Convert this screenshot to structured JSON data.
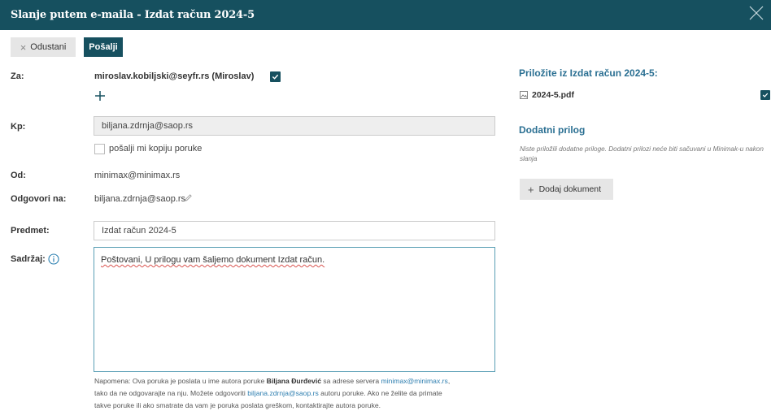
{
  "dialog": {
    "title": "Slanje putem e-maila - Izdat račun 2024-5"
  },
  "toolbar": {
    "cancel_label": "Odustani",
    "send_label": "Pošalji"
  },
  "form": {
    "to_label": "Za:",
    "to_value": "miroslav.kobiljski@seyfr.rs (Miroslav)",
    "to_checked": true,
    "cc_label": "Kp:",
    "cc_value": "biljana.zdrnja@saop.rs",
    "copy_label": "pošalji mi kopiju poruke",
    "copy_checked": false,
    "from_label": "Od:",
    "from_value": "minimax@minimax.rs",
    "reply_label": "Odgovori na:",
    "reply_value": "biljana.zdrnja@saop.rs",
    "subject_label": "Predmet:",
    "subject_value": "Izdat račun 2024-5",
    "content_label": "Sadržaj:",
    "content_value": "Poštovani, U prilogu vam šaljemo dokument Izdat račun."
  },
  "note": {
    "p1": "Napomena: Ova poruka je poslata u ime autora poruke ",
    "author": "Biljana Đurđević",
    "p2": " sa adrese servera ",
    "server": "minimax@minimax.rs",
    "p3": ",",
    "p4": "tako da ne odgovarajte na nju. Možete odgovoriti ",
    "reply_email": "biljana.zdrnja@saop.rs",
    "p5": " autoru poruke. Ako ne želite da primate",
    "p6": "takve poruke ili ako smatrate da vam je poruka poslata greškom, kontaktirajte autora poruke."
  },
  "attachments": {
    "title": "Priložite iz Izdat račun 2024-5:",
    "file_name": "2024-5.pdf",
    "file_checked": true,
    "extra_title": "Dodatni prilog",
    "extra_hint": "Niste priložili dodatne priloge. Dodatni prilozi neće biti sačuvani u Minimak-u nakon slanja",
    "add_button_label": "Dodaj dokument"
  },
  "colors": {
    "primary": "#16505f",
    "accent": "#2a6f92",
    "link": "#2f7fb0"
  }
}
